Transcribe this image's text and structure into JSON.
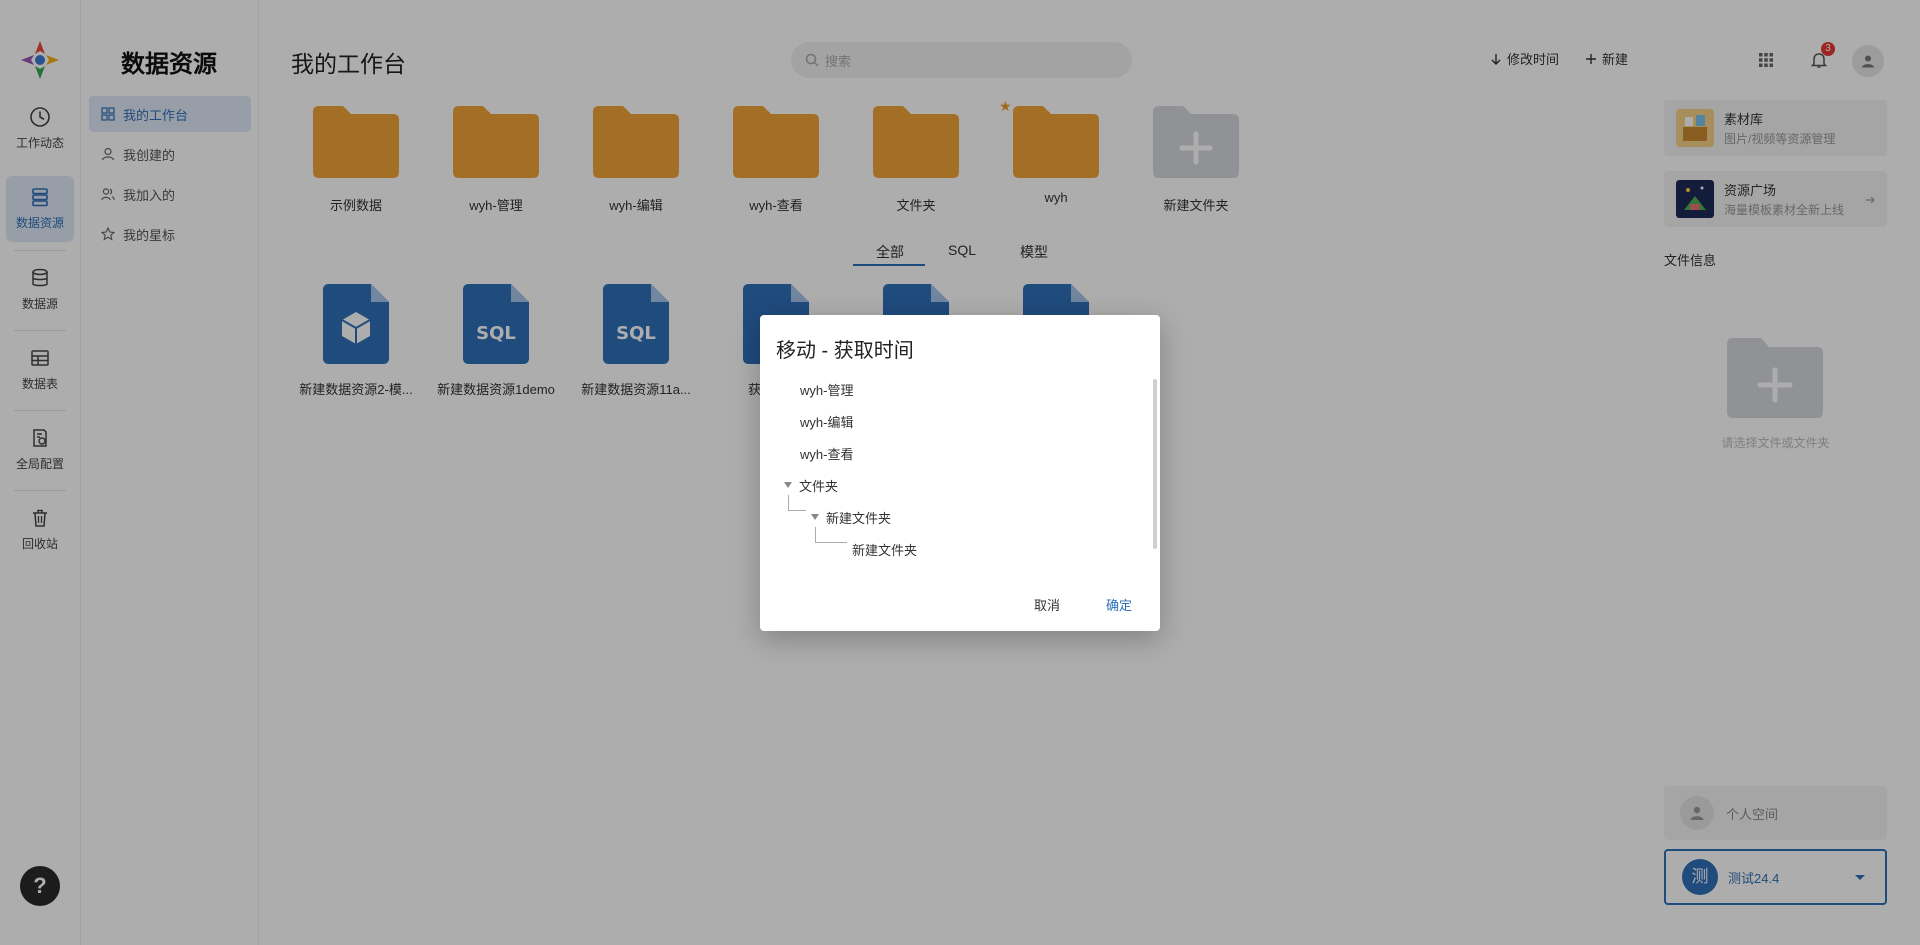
{
  "nav": {
    "items": [
      {
        "label": "工作动态",
        "icon": "clock-icon"
      },
      {
        "label": "数据资源",
        "icon": "database-stack-icon"
      },
      {
        "label": "数据源",
        "icon": "cylinder-icon"
      },
      {
        "label": "数据表",
        "icon": "table-icon"
      },
      {
        "label": "全局配置",
        "icon": "settings-doc-icon"
      },
      {
        "label": "回收站",
        "icon": "trash-icon"
      }
    ],
    "help": "?"
  },
  "sidebar": {
    "title": "数据资源",
    "items": [
      {
        "label": "我的工作台",
        "icon": "grid-icon"
      },
      {
        "label": "我创建的",
        "icon": "user-icon"
      },
      {
        "label": "我加入的",
        "icon": "users-icon"
      },
      {
        "label": "我的星标",
        "icon": "star-icon"
      }
    ]
  },
  "header": {
    "title": "我的工作台",
    "search_placeholder": "搜索",
    "sort_label": "修改时间",
    "new_label": "新建",
    "notification_count": "3"
  },
  "folders": [
    {
      "label": "示例数据"
    },
    {
      "label": "wyh-管理"
    },
    {
      "label": "wyh-编辑"
    },
    {
      "label": "wyh-查看"
    },
    {
      "label": "文件夹"
    },
    {
      "label": "wyh",
      "starred": true
    },
    {
      "label": "新建文件夹",
      "is_new": true
    }
  ],
  "tabs": [
    {
      "label": "全部"
    },
    {
      "label": "SQL"
    },
    {
      "label": "模型"
    }
  ],
  "files": [
    {
      "label": "新建数据资源2-模...",
      "type": "model"
    },
    {
      "label": "新建数据资源1demo",
      "type": "SQL"
    },
    {
      "label": "新建数据资源11a...",
      "type": "SQL"
    },
    {
      "label": "获",
      "type": "SQL"
    },
    {
      "label": "",
      "type": "SQL"
    },
    {
      "label": "",
      "type": "SQL"
    }
  ],
  "right_panel": {
    "cards": [
      {
        "title": "素材库",
        "subtitle": "图片/视频等资源管理"
      },
      {
        "title": "资源广场",
        "subtitle": "海量模板素材全新上线"
      }
    ],
    "file_info_label": "文件信息",
    "empty_text": "请选择文件或文件夹",
    "personal_label": "个人空间",
    "workspace_label": "测试24.4",
    "workspace_initial": "测"
  },
  "dialog": {
    "title": "移动 - 获取时间",
    "tree": [
      {
        "label": "wyh-管理"
      },
      {
        "label": "wyh-编辑"
      },
      {
        "label": "wyh-查看"
      },
      {
        "label": "文件夹"
      },
      {
        "label": "新建文件夹"
      },
      {
        "label": "新建文件夹"
      }
    ],
    "cancel": "取消",
    "confirm": "确定"
  },
  "colors": {
    "accent": "#2e6fb8",
    "folder": "#f0a238",
    "file": "#2e6fb8"
  }
}
